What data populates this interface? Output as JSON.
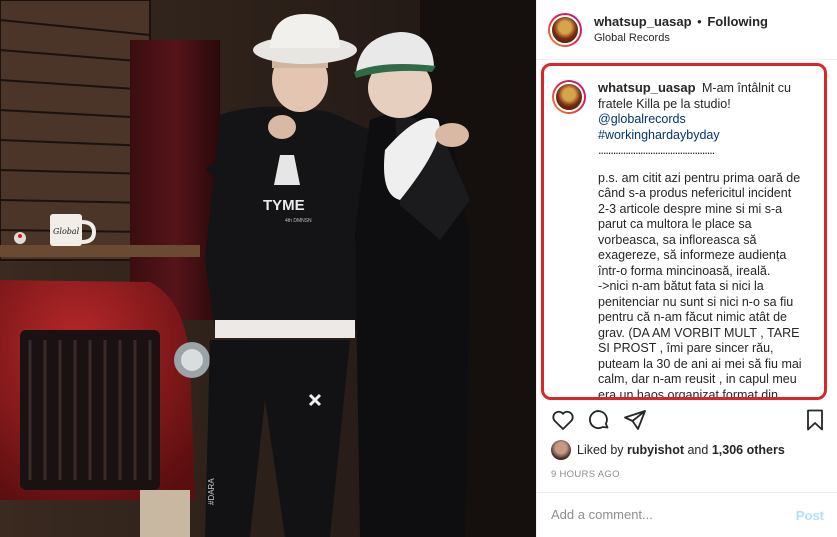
{
  "post": {
    "username": "whatsup_uasap",
    "separator": "•",
    "follow_status": "Following",
    "location": "Global Records"
  },
  "caption": {
    "username": "whatsup_uasap",
    "intro": "M-am întâlnit cu fratele Killa pe la studio!",
    "mention": "@globalrecords",
    "hashtag": "#workinghardaybyday",
    "divider": "...............................................",
    "ps_1": "p.s. am citit azi pentru prima oară de când s-a produs nefericitul incident 2-3 articole despre mine si mi s-a parut ca multora le place sa vorbeasca, sa infloreasca să exagereze, să informeze audiența într-o forma mincinoasă, ireală.",
    "ps_2": "->nici n-am bătut fata si nici la penitenciar nu sunt si nici n-o sa fiu pentru că n-am făcut nimic atât de grav. (DA AM VORBIT MULT , TARE SI PROST , îmi pare sincer rău, puteam la 30 de ani ai mei să fiu mai calm, dar n-am reusit , in capul meu era un haos organizat format din frustrari. ÎMI"
  },
  "icons": {
    "like": "heart-icon",
    "comment": "comment-icon",
    "share": "share-icon",
    "save": "bookmark-icon"
  },
  "likes": {
    "prefix": "Liked by",
    "user": "rubyishot",
    "middle": "and",
    "count": "1,306 others"
  },
  "timestamp": "9 HOURS AGO",
  "add_comment": {
    "placeholder": "Add a comment...",
    "post_label": "Post"
  },
  "photo_text": {
    "mug_text": "Global",
    "hoodie_text": "TYME",
    "hoodie_sub": "4th DMNSN",
    "pants_text": "#DARA"
  },
  "colors": {
    "highlight_border": "#d9262b",
    "link": "#00376b",
    "muted": "#8e8e8e",
    "post_disabled": "#b2dffc"
  }
}
